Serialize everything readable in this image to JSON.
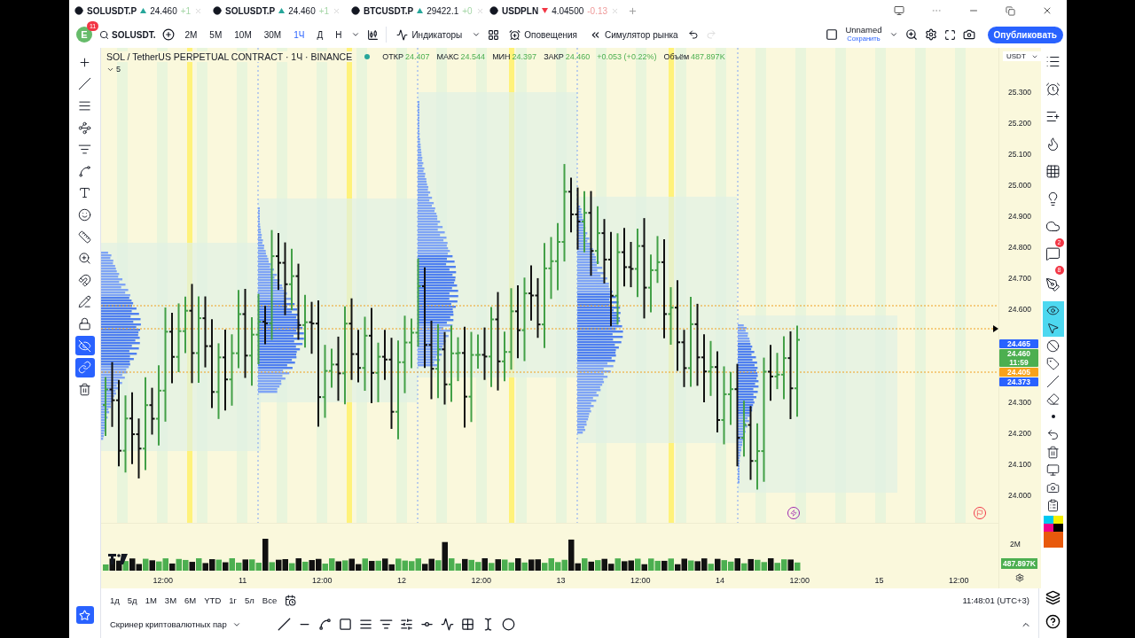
{
  "tabs": [
    {
      "symbol": "SOLUSDT.P",
      "rising": true,
      "price": "24.460",
      "change": "+1"
    },
    {
      "symbol": "SOLUSDT.P",
      "rising": true,
      "price": "24.460",
      "change": "+1"
    },
    {
      "symbol": "BTCUSDT.P",
      "rising": true,
      "price": "29422.1",
      "change": "+0"
    },
    {
      "symbol": "USDPLN",
      "rising": false,
      "price": "4.04500",
      "change": "-0.13"
    }
  ],
  "toolbar": {
    "avatar": "E",
    "notifications": "11",
    "symbol": "SOLUSDT.",
    "intervals": [
      {
        "label": "2М",
        "selected": false
      },
      {
        "label": "5М",
        "selected": false
      },
      {
        "label": "10М",
        "selected": false
      },
      {
        "label": "30М",
        "selected": false
      },
      {
        "label": "1Ч",
        "selected": true
      },
      {
        "label": "Д",
        "selected": false
      },
      {
        "label": "Н",
        "selected": false
      }
    ],
    "indicators": "Индикаторы",
    "alerts": "Оповещения",
    "replay": "Симулятор рынка",
    "layout_name": "Unnamed",
    "save": "Сохранить",
    "publish": "Опубликовать"
  },
  "left_toolbar": [
    {
      "kind": "crosshair",
      "active": false
    },
    {
      "kind": "trend-line",
      "active": false
    },
    {
      "kind": "fib",
      "active": false
    },
    {
      "kind": "pattern",
      "active": false
    },
    {
      "kind": "prediction",
      "active": false
    },
    {
      "kind": "brush",
      "active": false
    },
    {
      "kind": "text",
      "active": false
    },
    {
      "kind": "emoji",
      "active": false
    },
    {
      "kind": "ruler",
      "active": false
    },
    {
      "kind": "zoom",
      "active": false
    },
    {
      "kind": "magnet",
      "active": false
    },
    {
      "kind": "pencil",
      "active": false
    },
    {
      "kind": "lock",
      "active": false
    },
    {
      "kind": "hide",
      "active": true
    },
    {
      "kind": "link",
      "active": true
    },
    {
      "kind": "trash",
      "active": false
    }
  ],
  "legend": {
    "title": "SOL / TetherUS PERPETUAL CONTRACT · 1Ч · BINANCE",
    "values": [
      {
        "label": "ОТКР",
        "value": "24.407"
      },
      {
        "label": "МАКС",
        "value": "24.544"
      },
      {
        "label": "МИН",
        "value": "24.397"
      },
      {
        "label": "ЗАКР",
        "value": "24.460"
      }
    ],
    "change": "+0.053 (+0.22%)",
    "volume_label": "Объём",
    "volume": "487.897K",
    "indicator_count": "5"
  },
  "price_axis": {
    "currency": "USDT",
    "ticks_above": [
      "25.300",
      "25.200",
      "25.100",
      "25.000",
      "24.900",
      "24.800",
      "24.700",
      "24.600"
    ],
    "ticks_below": [
      "24.300",
      "24.200",
      "24.100",
      "24.000"
    ],
    "labels": [
      {
        "lines": [
          "24.465"
        ],
        "color": "#2962ff"
      },
      {
        "lines": [
          "24.460",
          "11:59"
        ],
        "color": "#4caf50"
      },
      {
        "lines": [
          "24.405"
        ],
        "color": "#f7a21b"
      },
      {
        "lines": [
          "24.373"
        ],
        "color": "#2962ff"
      }
    ]
  },
  "volume_axis": {
    "tick": "2M",
    "last": "487.897K"
  },
  "time_axis": [
    "12:00",
    "11",
    "12:00",
    "12",
    "12:00",
    "13",
    "12:00",
    "14",
    "12:00",
    "15",
    "12:00"
  ],
  "right_toolbar": [
    {
      "kind": "watchlist",
      "active": false
    },
    {
      "kind": "alarm",
      "active": false
    },
    {
      "kind": "add-list",
      "active": false
    },
    {
      "kind": "hotlist",
      "active": false
    },
    {
      "kind": "calendar",
      "active": false
    },
    {
      "kind": "ideas",
      "active": false
    },
    {
      "kind": "cloud",
      "active": false
    },
    {
      "kind": "chat",
      "active": false,
      "badge": "2"
    },
    {
      "kind": "pen",
      "active": false,
      "badge": "8"
    },
    {
      "kind": "eye",
      "active": true
    },
    {
      "kind": "cursor",
      "active": true
    },
    {
      "kind": "no-magnet",
      "active": false
    },
    {
      "kind": "tag",
      "active": false
    },
    {
      "kind": "line",
      "active": false
    },
    {
      "kind": "eraser",
      "active": false
    },
    {
      "kind": "dot",
      "active": false
    },
    {
      "kind": "undo",
      "active": false
    },
    {
      "kind": "trash",
      "active": false
    },
    {
      "kind": "monitor",
      "active": false
    },
    {
      "kind": "camera",
      "active": false
    },
    {
      "kind": "clipboard",
      "active": false
    }
  ],
  "ranges": [
    "1д",
    "5д",
    "1М",
    "3М",
    "6М",
    "YTD",
    "1г",
    "5л",
    "Все"
  ],
  "clock": "11:48:01 (UTC+3)",
  "screener": "Скринер криптовалютных пар"
}
